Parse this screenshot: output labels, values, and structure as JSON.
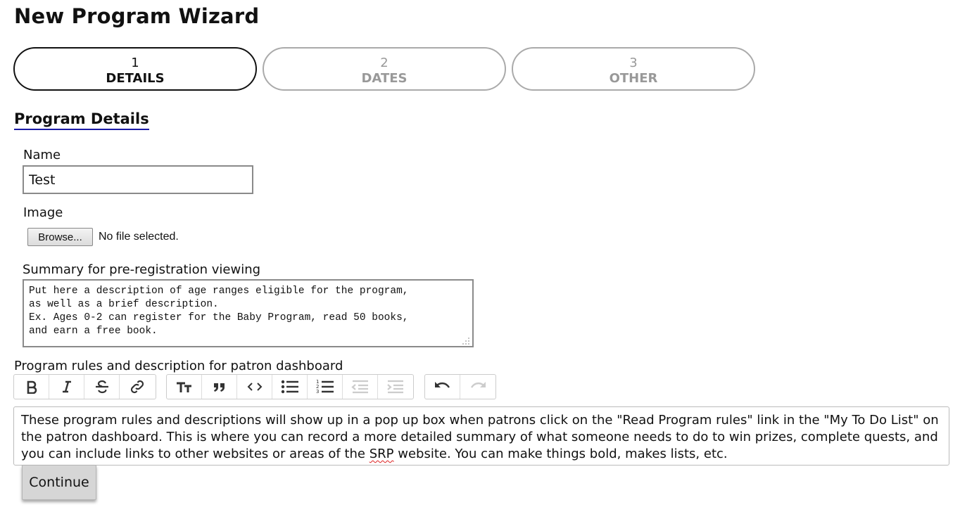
{
  "page": {
    "title": "New Program Wizard"
  },
  "steps": [
    {
      "number": "1",
      "label": "DETAILS",
      "state": "active"
    },
    {
      "number": "2",
      "label": "DATES",
      "state": "inactive"
    },
    {
      "number": "3",
      "label": "OTHER",
      "state": "inactive"
    }
  ],
  "section": {
    "heading": "Program Details"
  },
  "form": {
    "name_label": "Name",
    "name_value": "Test",
    "image_label": "Image",
    "browse_label": "Browse...",
    "file_status": "No file selected.",
    "summary_label": "Summary for pre-registration viewing",
    "summary_value": "Put here a description of age ranges eligible for the program,\nas well as a brief description.\nEx. Ages 0-2 can register for the Baby Program, read 50 books,\nand earn a free book.",
    "rules_label": "Program rules and description for patron dashboard",
    "rules_text_before": "These program rules and descriptions will show up in a pop up box when patrons click on the \"Read Program rules\" link in the \"My To Do List\" on the patron dashboard. This is where you can record a more detailed summary of what someone needs to do to win prizes, complete quests, and you can include links to other websites or areas of the ",
    "rules_text_flagged": "SRP",
    "rules_text_after": " website. You can make things bold, makes lists, etc.",
    "continue_label": "Continue"
  },
  "toolbar": {
    "groups": [
      [
        "bold-icon",
        "italic-icon",
        "strikethrough-icon",
        "link-icon"
      ],
      [
        "heading-icon",
        "quote-icon",
        "code-icon",
        "bullet-list-icon",
        "numbered-list-icon",
        "outdent-icon",
        "indent-icon"
      ],
      [
        "undo-icon",
        "redo-icon"
      ]
    ],
    "disabled": [
      "outdent-icon",
      "indent-icon",
      "redo-icon"
    ]
  },
  "colors": {
    "heading_underline": "#1a1aa6",
    "active_step_border": "#111111",
    "inactive_step_border": "#aaaaaa",
    "continue_bg": "#d6d6d6"
  }
}
